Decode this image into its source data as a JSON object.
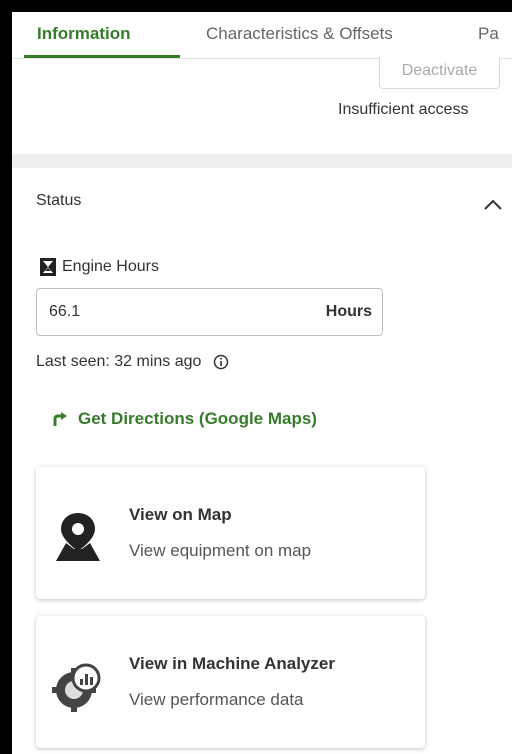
{
  "tabs": [
    {
      "label": "Information",
      "active": true
    },
    {
      "label": "Characteristics & Offsets",
      "active": false
    },
    {
      "label": "Pa",
      "active": false
    }
  ],
  "actions": {
    "deactivate_label": "Deactivate"
  },
  "access_message": "Insufficient access",
  "status": {
    "title": "Status",
    "engine_hours": {
      "label": "Engine Hours",
      "value": "66.1",
      "unit": "Hours"
    },
    "last_seen": "Last seen: 32 mins ago",
    "directions_label": "Get Directions (Google Maps)"
  },
  "cards": [
    {
      "title": "View on Map",
      "subtitle": "View equipment on map",
      "icon": "map-pin-icon"
    },
    {
      "title": "View in Machine Analyzer",
      "subtitle": "View performance data",
      "icon": "machine-analyzer-icon"
    }
  ],
  "colors": {
    "accent": "#367c2b",
    "text": "#333333",
    "muted": "#666666",
    "band": "#efefef"
  }
}
